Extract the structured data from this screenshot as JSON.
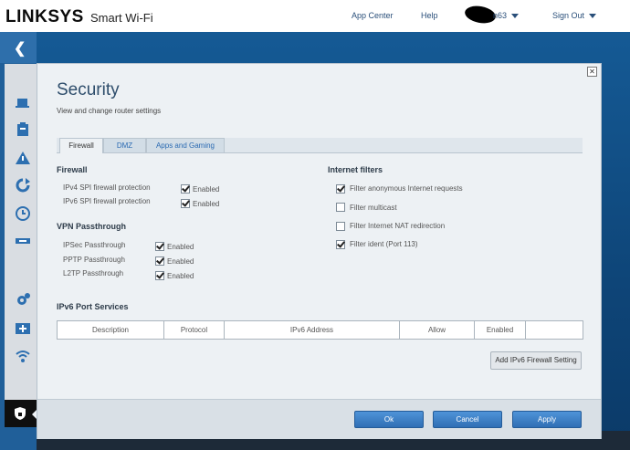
{
  "header": {
    "brand": "LINKSYS",
    "product": "Smart Wi-Fi",
    "links": {
      "app_center": "App Center",
      "help": "Help",
      "user": "n63",
      "sign_out": "Sign Out"
    }
  },
  "sidebar": {
    "items": [
      "laptop-icon",
      "clipboard-icon",
      "warning-icon",
      "refresh-icon",
      "clock-icon",
      "usb-icon",
      "gear-icon",
      "medkit-icon",
      "wifi-icon",
      "security-icon"
    ],
    "active_item": "security-icon"
  },
  "dialog": {
    "title": "Security",
    "subtitle": "View and change router settings",
    "tabs": [
      {
        "label": "Firewall",
        "active": true
      },
      {
        "label": "DMZ",
        "active": false
      },
      {
        "label": "Apps and Gaming",
        "active": false
      }
    ],
    "firewall": {
      "heading": "Firewall",
      "rows": [
        {
          "label": "IPv4 SPI firewall protection",
          "checkbox_label": "Enabled",
          "checked": true
        },
        {
          "label": "IPv6 SPI firewall protection",
          "checkbox_label": "Enabled",
          "checked": true
        }
      ]
    },
    "vpn": {
      "heading": "VPN Passthrough",
      "rows": [
        {
          "label": "IPSec Passthrough",
          "checkbox_label": "Enabled",
          "checked": true
        },
        {
          "label": "PPTP Passthrough",
          "checkbox_label": "Enabled",
          "checked": true
        },
        {
          "label": "L2TP Passthrough",
          "checkbox_label": "Enabled",
          "checked": true
        }
      ]
    },
    "internet_filters": {
      "heading": "Internet filters",
      "rows": [
        {
          "label": "Filter anonymous Internet requests",
          "checked": true
        },
        {
          "label": "Filter multicast",
          "checked": false
        },
        {
          "label": "Filter Internet NAT redirection",
          "checked": false
        },
        {
          "label": "Filter ident (Port 113)",
          "checked": true
        }
      ]
    },
    "ipv6": {
      "heading": "IPv6 Port Services",
      "columns": [
        "Description",
        "Protocol",
        "IPv6 Address",
        "Allow",
        "Enabled",
        ""
      ],
      "add_button": "Add IPv6 Firewall Setting"
    },
    "footer": {
      "ok": "Ok",
      "cancel": "Cancel",
      "apply": "Apply"
    },
    "close_icon": "close-icon"
  },
  "colors": {
    "accent_blue": "#2f6fb5",
    "background_blue": "#0f4a80",
    "sidebar_blue": "#205f99"
  }
}
